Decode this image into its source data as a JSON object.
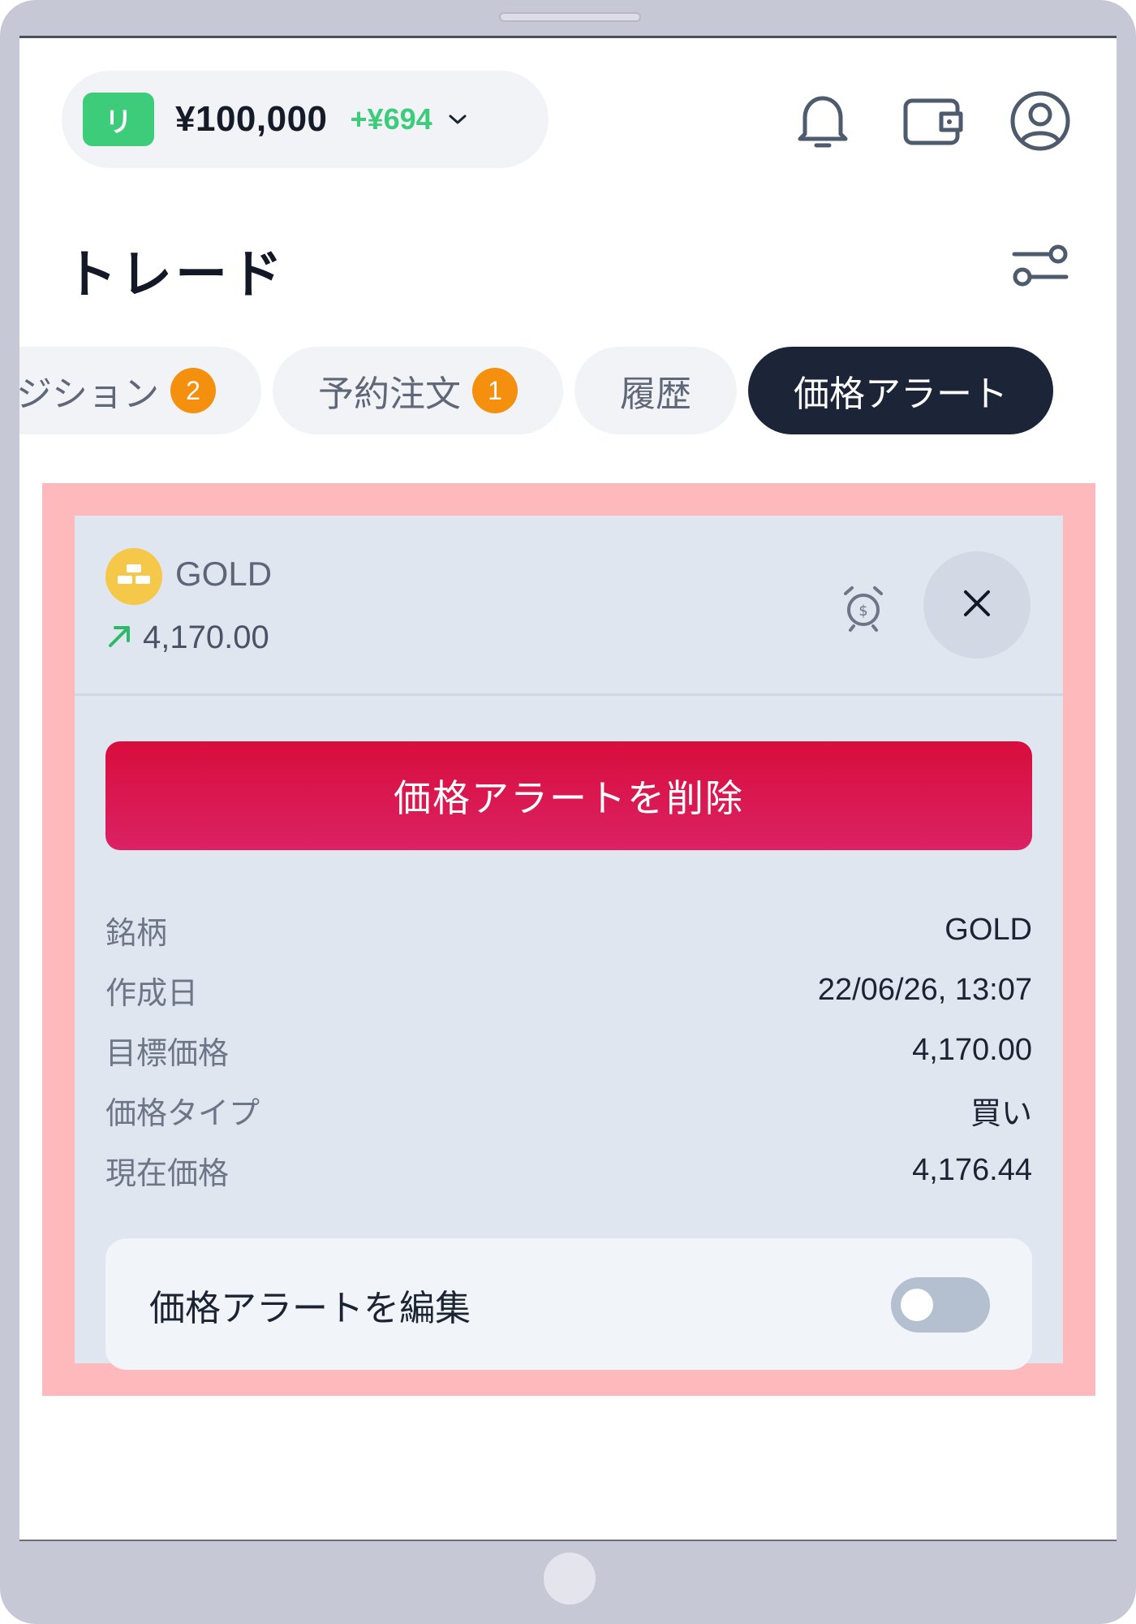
{
  "header": {
    "account_badge": "リ",
    "balance": "¥100,000",
    "balance_change": "+¥694",
    "icons": [
      "bell-icon",
      "wallet-icon",
      "profile-icon"
    ]
  },
  "page": {
    "title": "トレード"
  },
  "tabs": [
    {
      "label": "ジション",
      "count": "2"
    },
    {
      "label": "予約注文",
      "count": "1"
    },
    {
      "label": "履歴"
    },
    {
      "label": "価格アラート",
      "active": true
    }
  ],
  "alert": {
    "symbol": "GOLD",
    "price": "4,170.00",
    "delete_label": "価格アラートを削除",
    "details": [
      {
        "label": "銘柄",
        "value": "GOLD"
      },
      {
        "label": "作成日",
        "value": "22/06/26, 13:07"
      },
      {
        "label": "目標価格",
        "value": "4,170.00"
      },
      {
        "label": "価格タイプ",
        "value": "買い"
      },
      {
        "label": "現在価格",
        "value": "4,176.44"
      }
    ],
    "edit_label": "価格アラートを編集",
    "edit_enabled": false
  },
  "colors": {
    "accent_green": "#3dcc7a",
    "delete_red": "#d80d3c",
    "badge_orange": "#f5900f",
    "active_tab": "#1b2537",
    "highlight": "#fdb9bc"
  }
}
